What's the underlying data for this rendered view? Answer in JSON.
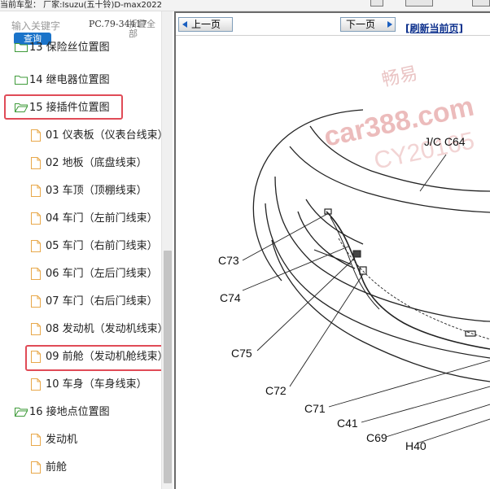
{
  "header": {
    "current_car": "当前车型： 厂家:Isuzu(五十铃)D-max2022"
  },
  "search": {
    "placeholder": "输入关键字",
    "button_label": "查询"
  },
  "pc_label": "PC.79-34417",
  "collapse_all_label": "折叠全部",
  "tree": {
    "partial_item": "13 保险丝位置图",
    "items": [
      {
        "label": "14 继电器位置图",
        "type": "folder"
      },
      {
        "label": "15 接插件位置图",
        "type": "folder-open"
      },
      {
        "label": "01 仪表板（仪表台线束）",
        "type": "doc"
      },
      {
        "label": "02 地板（底盘线束）",
        "type": "doc"
      },
      {
        "label": "03 车顶（顶棚线束）",
        "type": "doc"
      },
      {
        "label": "04 车门（左前门线束）",
        "type": "doc"
      },
      {
        "label": "05 车门（右前门线束）",
        "type": "doc"
      },
      {
        "label": "06 车门（左后门线束）",
        "type": "doc"
      },
      {
        "label": "07 车门（右后门线束）",
        "type": "doc"
      },
      {
        "label": "08 发动机（发动机线束）",
        "type": "doc"
      },
      {
        "label": "09 前舱（发动机舱线束）",
        "type": "doc"
      },
      {
        "label": "10 车身（车身线束）",
        "type": "doc"
      },
      {
        "label": "16 接地点位置图",
        "type": "folder-open"
      },
      {
        "label": "发动机",
        "type": "doc"
      },
      {
        "label": "前舱",
        "type": "doc"
      }
    ]
  },
  "nav": {
    "prev_label": "上一页",
    "next_label": "下一页",
    "refresh_label": "[刷新当前页]"
  },
  "diagram": {
    "labels": [
      "J/C C64",
      "C73",
      "C74",
      "C75",
      "C72",
      "C71",
      "C41",
      "C69",
      "H40"
    ],
    "watermark": {
      "line1": "畅易",
      "line2": "car388.com",
      "line3": "CY20165"
    }
  },
  "colors": {
    "highlight": "#e04b57",
    "folder": "#3f9b3a",
    "doc": "#e8a84a",
    "button_blue": "#1a73c9",
    "link": "#0b2f8c",
    "watermark": "#e9b0b0"
  }
}
